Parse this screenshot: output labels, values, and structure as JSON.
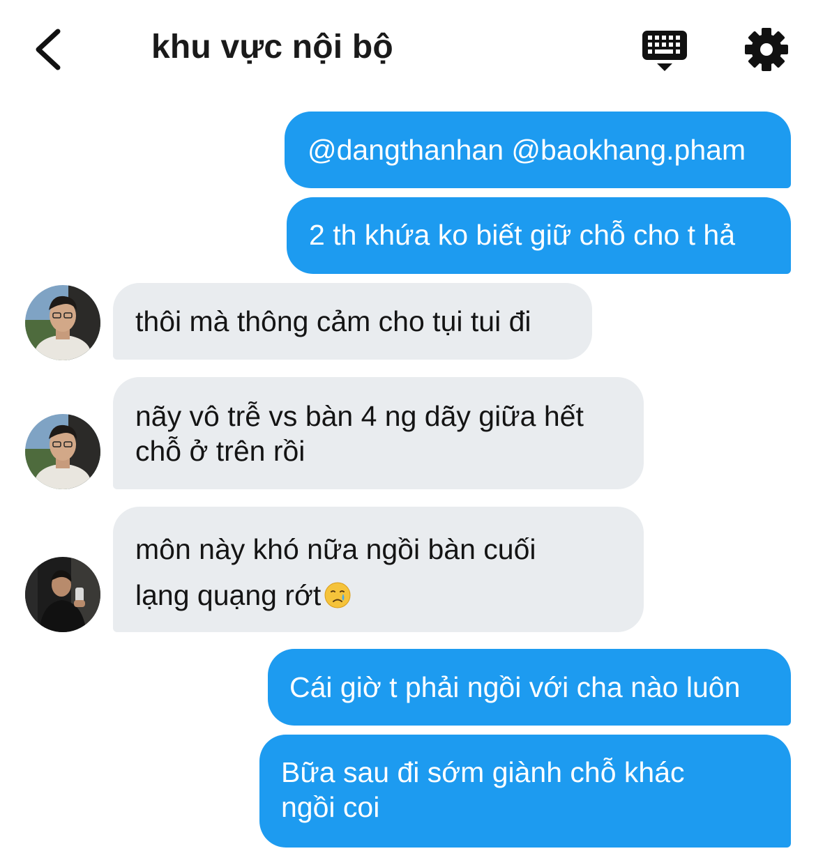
{
  "header": {
    "back_icon": "chevron-left-icon",
    "title": "khu vực nội bộ",
    "keyboard_icon": "keyboard-icon",
    "settings_icon": "gear-icon"
  },
  "messages": [
    {
      "side": "out",
      "lines": [
        "@dangthanhan @baokhang.pham"
      ]
    },
    {
      "side": "out",
      "lines": [
        "2 th khứa ko biết giữ chỗ cho t hả"
      ]
    },
    {
      "side": "in",
      "avatar": "avatar-user-glasses",
      "lines": [
        "thôi mà thông cảm cho tụi tui đi"
      ]
    },
    {
      "side": "in",
      "avatar": "avatar-user-glasses",
      "lines": [
        "nãy vô trễ vs bàn 4 ng dãy giữa hết",
        "chỗ ở trên rồi"
      ]
    },
    {
      "side": "in",
      "avatar": "avatar-user-mirror",
      "lines": [
        "môn này khó nữa ngồi bàn cuối",
        "lạng quạng rớt"
      ],
      "emoji": "crying-face-icon"
    },
    {
      "side": "out",
      "lines": [
        "Cái giờ t phải ngồi với cha nào luôn"
      ]
    },
    {
      "side": "out",
      "lines": [
        "Bữa sau đi sớm giành chỗ khác",
        "ngồi coi"
      ]
    }
  ],
  "colors": {
    "outgoing_bubble": "#1d9bf0",
    "incoming_bubble": "#e9ecef",
    "outgoing_text": "#ffffff",
    "incoming_text": "#141414"
  }
}
